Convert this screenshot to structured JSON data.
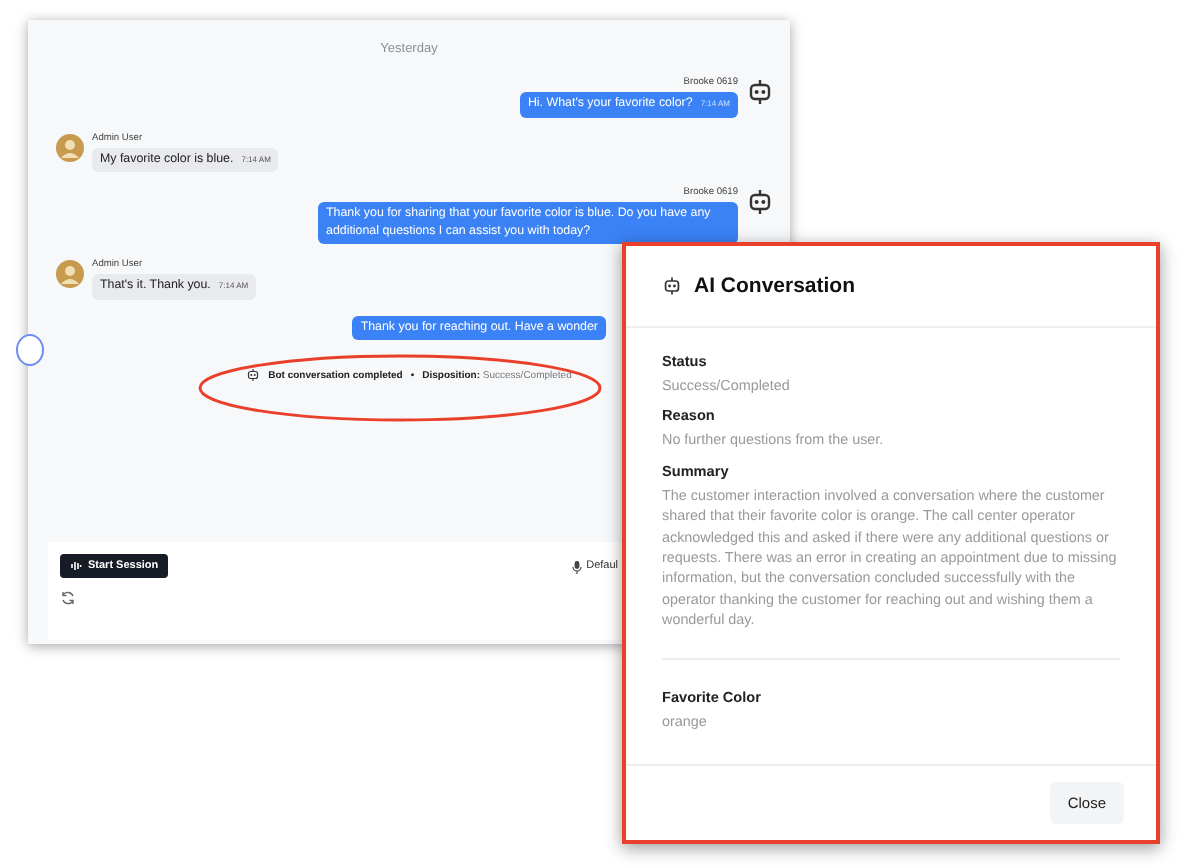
{
  "chat": {
    "date_divider": "Yesterday",
    "messages": [
      {
        "kind": "bot",
        "sender": "Brooke 0619",
        "text": "Hi. What's your favorite color?",
        "time": "7:14 AM",
        "avatar": true
      },
      {
        "kind": "user",
        "sender": "Admin User",
        "text": "My favorite color is blue.",
        "time": "7:14 AM",
        "avatar": true
      },
      {
        "kind": "bot",
        "sender": "Brooke 0619",
        "text": "Thank you for sharing that your favorite color is blue. Do you have any additional questions I can assist you with today?",
        "avatar": true
      },
      {
        "kind": "user",
        "sender": "Admin User",
        "text": "That's it. Thank you.",
        "time": "7:14 AM",
        "avatar": true
      },
      {
        "kind": "bot",
        "text": "Thank you for reaching out. Have a wonder",
        "avatar": false
      }
    ],
    "disposition": {
      "label": "Bot conversation completed",
      "separator": "•",
      "key": "Disposition:",
      "value": "Success/Completed"
    },
    "start_button": "Start Session",
    "voice": "Defaul"
  },
  "dialog": {
    "title": "AI Conversation",
    "sections": [
      [
        {
          "label": "Status",
          "value": "Success/Completed"
        },
        {
          "label": "Reason",
          "value": "No further questions from the user."
        },
        {
          "label": "Summary",
          "value": "The customer interaction involved a conversation where the customer shared that their favorite color is orange. The call center operator acknowledged this and asked if there were any additional questions or requests. There was an error in creating an appointment due to missing information, but the conversation concluded successfully with the operator thanking the customer for reaching out and wishing them a wonderful day."
        }
      ],
      [
        {
          "label": "Favorite Color",
          "value": "orange"
        }
      ]
    ],
    "close_button": "Close"
  }
}
